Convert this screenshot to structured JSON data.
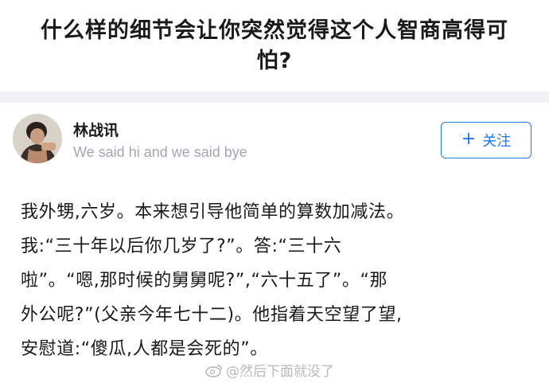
{
  "question": {
    "title_line1": "什么样的细节会让你突然觉得这个人智商高得可",
    "title_line2": "怕?"
  },
  "author": {
    "name": "林战讯",
    "bio": "We said hi and we said bye",
    "follow_label": "关注",
    "follow_icon": "plus-icon"
  },
  "answer": {
    "lines": [
      "我外甥,六岁。本来想引导他简单的算数加减法。",
      "我:“三十年以后你几岁了?”。答:“三十六",
      "啦”。“嗯,那时候的舅舅呢?”,“六十五了”。“那",
      "外公呢?”(父亲今年七十二)。他指着天空望了望,",
      "安慰道:“傻瓜,人都是会死的”。"
    ]
  },
  "watermark": {
    "text": "@然后下面就没了",
    "icon": "weibo-icon"
  },
  "colors": {
    "accent": "#1e78e6",
    "divider": "#f1f2f5",
    "muted": "#a3a7ad"
  }
}
